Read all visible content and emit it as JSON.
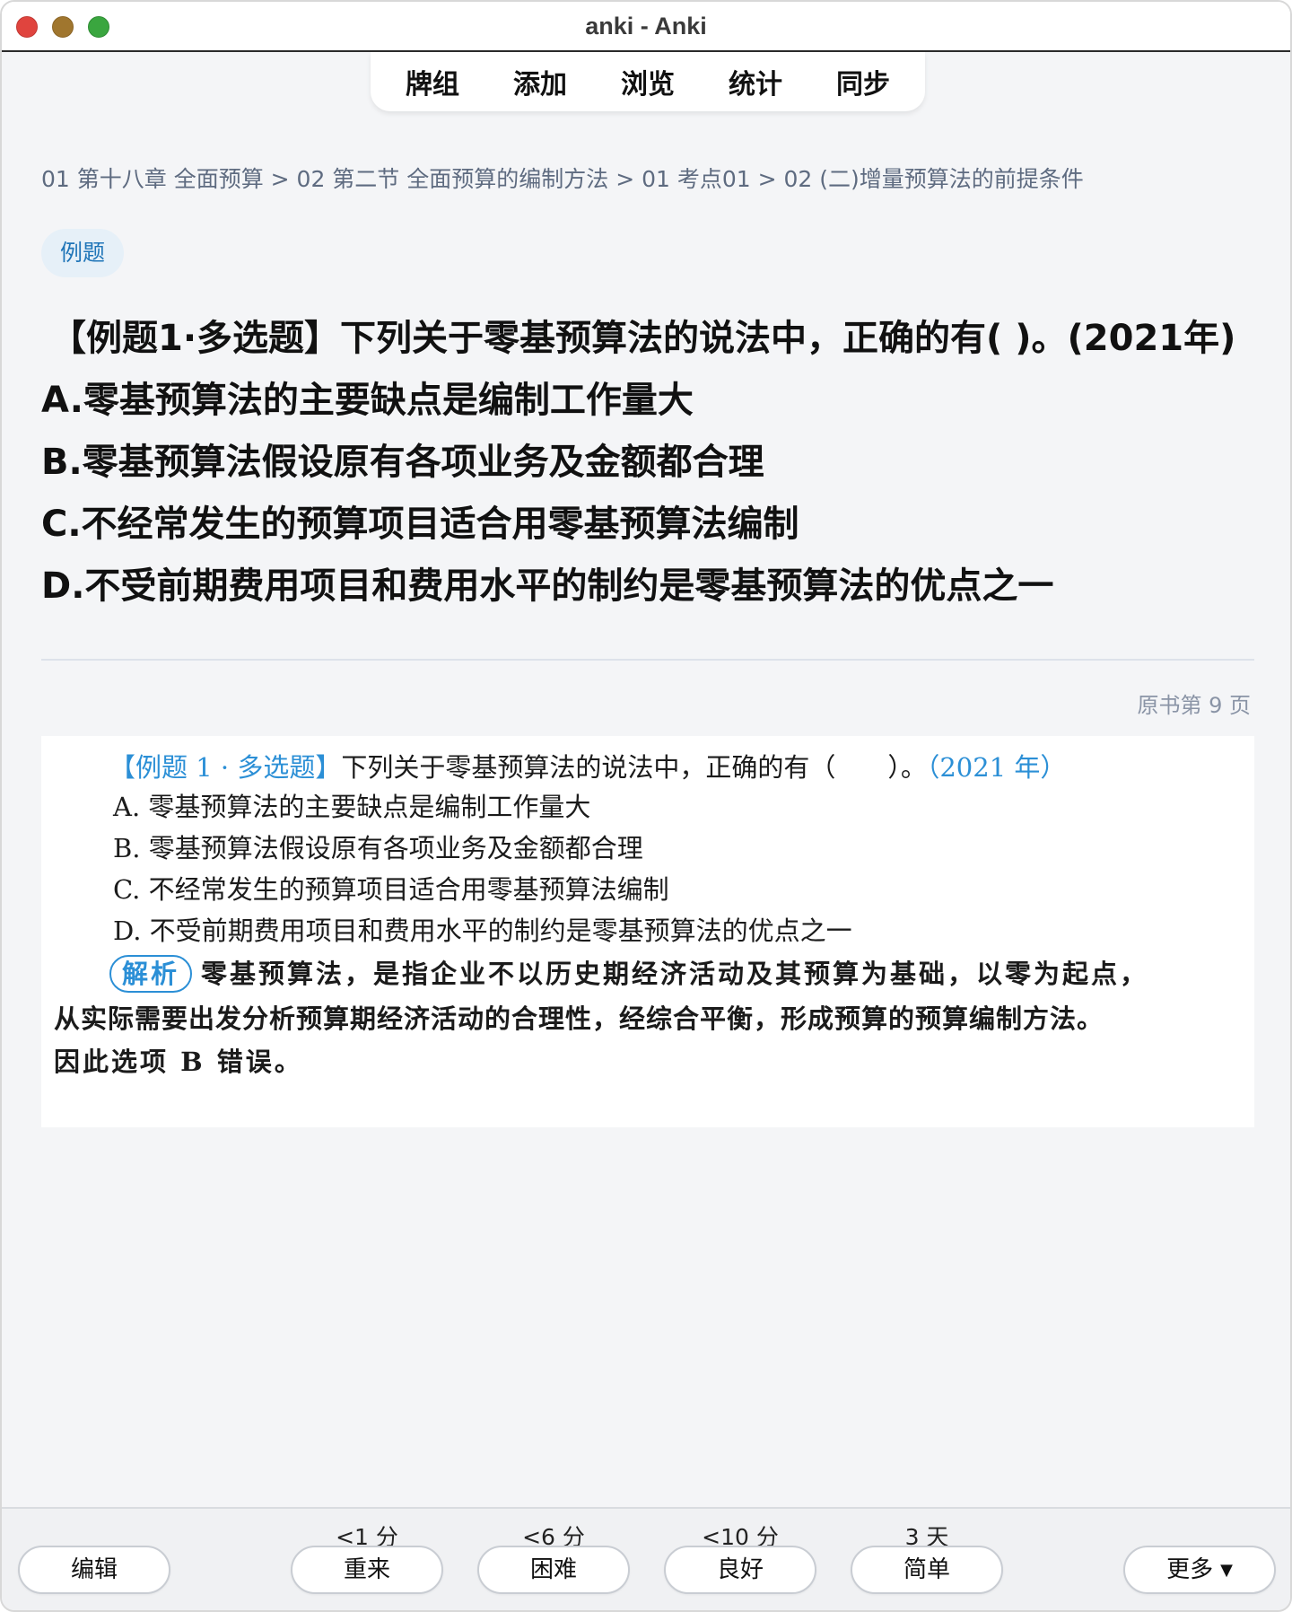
{
  "window": {
    "title": "anki - Anki"
  },
  "nav": {
    "items": [
      "牌组",
      "添加",
      "浏览",
      "统计",
      "同步"
    ]
  },
  "breadcrumb": "01 第十八章 全面预算 > 02 第二节 全面预算的编制方法 > 01 考点01 > 02 (二)增量预算法的前提条件",
  "tag": "例题",
  "question": {
    "title": "【例题1·多选题】下列关于零基预算法的说法中，正确的有( )。(2021年)",
    "options": [
      "A.零基预算法的主要缺点是编制工作量大",
      "B.零基预算法假设原有各项业务及金额都合理",
      "C.不经常发生的预算项目适合用零基预算法编制",
      "D.不受前期费用项目和费用水平的制约是零基预算法的优点之一"
    ]
  },
  "page_ref": "原书第 9 页",
  "scan": {
    "heading_label": "【例题 1 · 多选题】",
    "heading_text": "下列关于零基预算法的说法中，正确的有（　　）。",
    "heading_year": "（2021 年）",
    "options": [
      "A. 零基预算法的主要缺点是编制工作量大",
      "B. 零基预算法假设原有各项业务及金额都合理",
      "C. 不经常发生的预算项目适合用零基预算法编制",
      "D. 不受前期费用项目和费用水平的制约是零基预算法的优点之一"
    ],
    "explanation_badge": "解析",
    "explanation_lines": [
      "零基预算法，是指企业不以历史期经济活动及其预算为基础，以零为起点，",
      "从实际需要出发分析预算期经济活动的合理性，经综合平衡，形成预算的预算编制方法。",
      "因此选项 B 错误。"
    ]
  },
  "bottom": {
    "edit_label": "编辑",
    "more_label": "更多",
    "answers": [
      {
        "interval": "<1 分",
        "label": "重来"
      },
      {
        "interval": "<6 分",
        "label": "困难"
      },
      {
        "interval": "<10 分",
        "label": "良好"
      },
      {
        "interval": "3 天",
        "label": "简单"
      }
    ]
  }
}
